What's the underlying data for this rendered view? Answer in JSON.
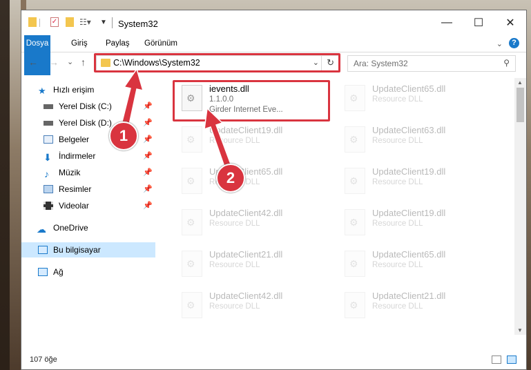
{
  "window": {
    "title": "System32",
    "controls": {
      "minimize": "—",
      "maximize": "☐",
      "close": "✕"
    }
  },
  "ribbon": {
    "tabs": [
      "Dosya",
      "Giriş",
      "Paylaş",
      "Görünüm"
    ],
    "help": "?"
  },
  "navigation": {
    "back": "←",
    "forward": "→",
    "recent": "⌄",
    "up": "↑",
    "address": "C:\\Windows\\System32",
    "search_placeholder": "Ara: System32"
  },
  "sidebar": {
    "items": [
      {
        "label": "Hızlı erişim",
        "icon": "star-icon",
        "pinned": false
      },
      {
        "label": "Yerel Disk (C:)",
        "icon": "drive-icon",
        "pinned": true
      },
      {
        "label": "Yerel Disk (D:)",
        "icon": "drive-icon",
        "pinned": true
      },
      {
        "label": "Belgeler",
        "icon": "documents-icon",
        "pinned": true
      },
      {
        "label": "İndirmeler",
        "icon": "download-icon",
        "pinned": true
      },
      {
        "label": "Müzik",
        "icon": "music-icon",
        "pinned": true
      },
      {
        "label": "Resimler",
        "icon": "pictures-icon",
        "pinned": true
      },
      {
        "label": "Videolar",
        "icon": "video-icon",
        "pinned": true
      },
      {
        "label": "OneDrive",
        "icon": "cloud-icon",
        "pinned": false
      },
      {
        "label": "Bu bilgisayar",
        "icon": "computer-icon",
        "pinned": false,
        "selected": true
      },
      {
        "label": "Ağ",
        "icon": "network-icon",
        "pinned": false
      }
    ]
  },
  "files": [
    {
      "name": "ievents.dll",
      "line1": "1.1.0.0",
      "line2": "Girder Internet Eve...",
      "highlighted": true
    },
    {
      "name": "UpdateClient65.dll",
      "line1": "Resource DLL"
    },
    {
      "name": "UpdateClient19.dll",
      "line1": "Resource DLL"
    },
    {
      "name": "UpdateClient63.dll",
      "line1": "Resource DLL"
    },
    {
      "name": "UpdateClient65.dll",
      "line1": "Resource DLL"
    },
    {
      "name": "UpdateClient19.dll",
      "line1": "Resource DLL"
    },
    {
      "name": "UpdateClient42.dll",
      "line1": "Resource DLL"
    },
    {
      "name": "UpdateClient19.dll",
      "line1": "Resource DLL"
    },
    {
      "name": "UpdateClient21.dll",
      "line1": "Resource DLL"
    },
    {
      "name": "UpdateClient65.dll",
      "line1": "Resource DLL"
    },
    {
      "name": "UpdateClient42.dll",
      "line1": "Resource DLL"
    },
    {
      "name": "UpdateClient21.dll",
      "line1": "Resource DLL"
    }
  ],
  "status": {
    "item_count": "107 öğe"
  },
  "callouts": [
    "1",
    "2"
  ],
  "colors": {
    "accent": "#1979ca",
    "highlight": "#d9343f",
    "selection": "#cce8ff"
  }
}
